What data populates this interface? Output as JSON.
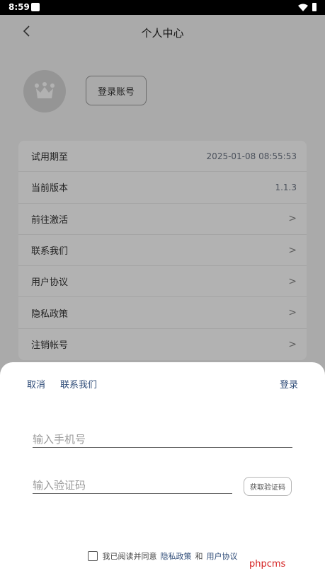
{
  "status_bar": {
    "time": "8:59"
  },
  "header": {
    "title": "个人中心"
  },
  "profile": {
    "login_button": "登录账号"
  },
  "info_list": [
    {
      "label": "试用期至",
      "value": "2025-01-08 08:55:53"
    },
    {
      "label": "当前版本",
      "value": "1.1.3"
    },
    {
      "label": "前往激活",
      "arrow": ">"
    },
    {
      "label": "联系我们",
      "arrow": ">"
    },
    {
      "label": "用户协议",
      "arrow": ">"
    },
    {
      "label": "隐私政策",
      "arrow": ">"
    },
    {
      "label": "注销帐号",
      "arrow": ">"
    }
  ],
  "sheet": {
    "cancel": "取消",
    "contact": "联系我们",
    "login": "登录",
    "phone_placeholder": "输入手机号",
    "code_placeholder": "输入验证码",
    "get_code": "获取验证码",
    "agreement": {
      "prefix": "我已阅读并同意",
      "privacy": "隐私政策",
      "and": "和",
      "terms": "用户协议"
    }
  },
  "watermark": "phpcms",
  "colors": {
    "link": "#2f4c78",
    "overlay": "rgba(0,0,0,0.30)",
    "watermark": "#d42020"
  },
  "icons": [
    "wifi-icon",
    "battery-icon",
    "back-icon",
    "crown-icon",
    "chevron-right-icon",
    "checkbox"
  ]
}
